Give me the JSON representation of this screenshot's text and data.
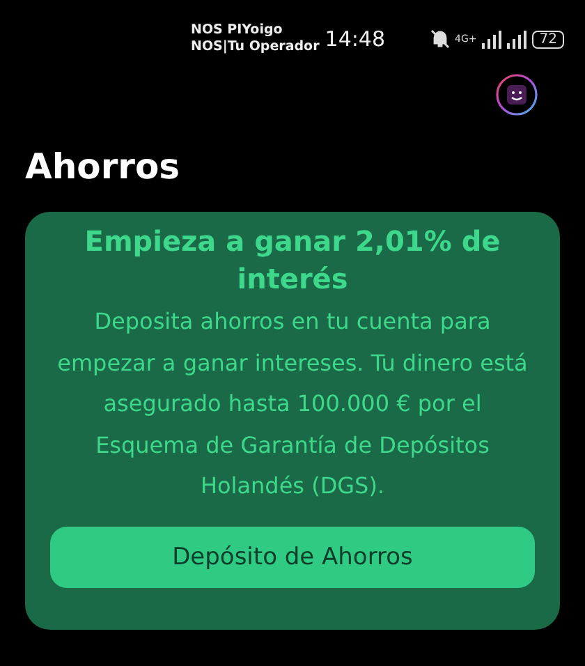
{
  "status_bar": {
    "carriers": [
      "NOS PIYoigo",
      "NOS|Tu Operador"
    ],
    "time": "14:48",
    "network": "4G+",
    "battery": "72"
  },
  "title": "Ahorros",
  "promo_card": {
    "heading": "Empieza a ganar 2,01% de interés",
    "body": "Deposita ahorros en tu cuenta para empezar a ganar intereses. Tu dinero está asegurado hasta 100.000 € por el Esquema de Garantía de Depósitos Holandés (DGS).",
    "button": "Depósito de Ahorros"
  }
}
